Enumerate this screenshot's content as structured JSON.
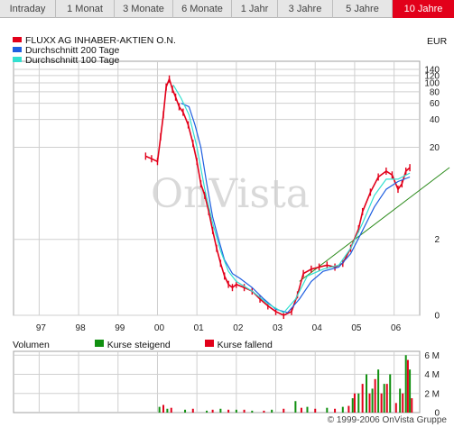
{
  "tabs": [
    {
      "label": "Intraday",
      "active": false
    },
    {
      "label": "1 Monat",
      "active": false
    },
    {
      "label": "3 Monate",
      "active": false
    },
    {
      "label": "6 Monate",
      "active": false
    },
    {
      "label": "1 Jahr",
      "active": false
    },
    {
      "label": "3 Jahre",
      "active": false
    },
    {
      "label": "5 Jahre",
      "active": false
    },
    {
      "label": "10 Jahre",
      "active": true
    }
  ],
  "legend": [
    {
      "label": "FLUXX AG INHABER-AKTIEN O.N.",
      "color": "#e2001a"
    },
    {
      "label": "Durchschnitt 200 Tage",
      "color": "#1f5fe0"
    },
    {
      "label": "Durchschnitt 100 Tage",
      "color": "#33e0d0"
    }
  ],
  "currency": "EUR",
  "watermark": "OnVista",
  "volume_legend": {
    "title": "Volumen",
    "rising": {
      "label": "Kurse steigend",
      "color": "#109010"
    },
    "falling": {
      "label": "Kurse fallend",
      "color": "#e2001a"
    }
  },
  "copyright": "© 1999-2006 OnVista Gruppe",
  "colors": {
    "trendline": "#2a8a1a",
    "grid": "#cfcfcf"
  },
  "chart_data": [
    {
      "type": "line",
      "x": [
        "97",
        "98",
        "99",
        "00",
        "01",
        "02",
        "03",
        "04",
        "05",
        "06"
      ],
      "yscale": "log",
      "yticks": [
        0,
        2,
        20,
        40,
        60,
        80,
        100,
        120,
        140
      ],
      "series": [
        {
          "name": "FLUXX AG INHABER-AKTIEN O.N.",
          "color": "#e2001a",
          "points": [
            [
              1999.7,
              16
            ],
            [
              1999.85,
              15
            ],
            [
              2000.0,
              14
            ],
            [
              2000.08,
              26
            ],
            [
              2000.15,
              45
            ],
            [
              2000.22,
              90
            ],
            [
              2000.3,
              110
            ],
            [
              2000.38,
              85
            ],
            [
              2000.46,
              70
            ],
            [
              2000.55,
              55
            ],
            [
              2000.65,
              48
            ],
            [
              2000.78,
              35
            ],
            [
              2000.9,
              22
            ],
            [
              2001.0,
              14
            ],
            [
              2001.1,
              8
            ],
            [
              2001.2,
              6
            ],
            [
              2001.3,
              4
            ],
            [
              2001.4,
              2.5
            ],
            [
              2001.5,
              1.6
            ],
            [
              2001.6,
              1.1
            ],
            [
              2001.7,
              0.8
            ],
            [
              2001.8,
              0.65
            ],
            [
              2001.9,
              0.6
            ],
            [
              2002.0,
              0.65
            ],
            [
              2002.2,
              0.6
            ],
            [
              2002.4,
              0.55
            ],
            [
              2002.6,
              0.45
            ],
            [
              2002.8,
              0.38
            ],
            [
              2003.0,
              0.33
            ],
            [
              2003.2,
              0.3
            ],
            [
              2003.4,
              0.33
            ],
            [
              2003.55,
              0.5
            ],
            [
              2003.7,
              0.85
            ],
            [
              2003.9,
              0.95
            ],
            [
              2004.1,
              1.0
            ],
            [
              2004.3,
              1.05
            ],
            [
              2004.5,
              1.0
            ],
            [
              2004.7,
              1.1
            ],
            [
              2004.9,
              1.6
            ],
            [
              2005.1,
              2.6
            ],
            [
              2005.2,
              4.0
            ],
            [
              2005.4,
              6.5
            ],
            [
              2005.6,
              9.5
            ],
            [
              2005.8,
              11
            ],
            [
              2005.95,
              10
            ],
            [
              2006.1,
              7
            ],
            [
              2006.2,
              8
            ],
            [
              2006.3,
              11
            ],
            [
              2006.4,
              12
            ]
          ]
        },
        {
          "name": "Durchschnitt 200 Tage",
          "color": "#1f5fe0",
          "points": [
            [
              2000.6,
              60
            ],
            [
              2000.8,
              55
            ],
            [
              2000.95,
              35
            ],
            [
              2001.1,
              20
            ],
            [
              2001.25,
              8
            ],
            [
              2001.4,
              3.5
            ],
            [
              2001.55,
              2.0
            ],
            [
              2001.7,
              1.2
            ],
            [
              2001.9,
              0.85
            ],
            [
              2002.1,
              0.75
            ],
            [
              2002.4,
              0.6
            ],
            [
              2002.7,
              0.45
            ],
            [
              2003.0,
              0.35
            ],
            [
              2003.3,
              0.32
            ],
            [
              2003.6,
              0.45
            ],
            [
              2003.9,
              0.7
            ],
            [
              2004.2,
              0.9
            ],
            [
              2004.6,
              1.0
            ],
            [
              2004.9,
              1.4
            ],
            [
              2005.2,
              2.5
            ],
            [
              2005.5,
              4.5
            ],
            [
              2005.8,
              7
            ],
            [
              2006.1,
              8.5
            ],
            [
              2006.4,
              9.5
            ]
          ]
        },
        {
          "name": "Durchschnitt 100 Tage",
          "color": "#33e0d0",
          "points": [
            [
              2000.4,
              95
            ],
            [
              2000.6,
              68
            ],
            [
              2000.8,
              45
            ],
            [
              2001.0,
              20
            ],
            [
              2001.2,
              7
            ],
            [
              2001.4,
              3.0
            ],
            [
              2001.6,
              1.5
            ],
            [
              2001.8,
              0.9
            ],
            [
              2002.0,
              0.7
            ],
            [
              2002.4,
              0.55
            ],
            [
              2002.8,
              0.4
            ],
            [
              2003.2,
              0.32
            ],
            [
              2003.5,
              0.45
            ],
            [
              2003.8,
              0.8
            ],
            [
              2004.2,
              0.95
            ],
            [
              2004.6,
              1.05
            ],
            [
              2004.9,
              1.6
            ],
            [
              2005.2,
              3.0
            ],
            [
              2005.5,
              6.0
            ],
            [
              2005.8,
              9
            ],
            [
              2006.1,
              9
            ],
            [
              2006.4,
              10.5
            ]
          ]
        }
      ],
      "trendline": {
        "from": [
          2003.6,
          0.7
        ],
        "to": [
          2006.85,
          34
        ]
      }
    },
    {
      "type": "bar",
      "yticks": [
        "0",
        "2 M",
        "4 M",
        "6 M"
      ],
      "ylim": [
        0,
        6.4
      ],
      "unit": "M",
      "series": [
        {
          "name": "Kurse steigend",
          "color": "#109010",
          "points": [
            [
              2000.05,
              0.6
            ],
            [
              2000.25,
              0.4
            ],
            [
              2000.7,
              0.3
            ],
            [
              2001.25,
              0.2
            ],
            [
              2001.6,
              0.4
            ],
            [
              2002.0,
              0.3
            ],
            [
              2002.4,
              0.2
            ],
            [
              2002.9,
              0.3
            ],
            [
              2003.5,
              1.2
            ],
            [
              2003.8,
              0.6
            ],
            [
              2004.3,
              0.5
            ],
            [
              2004.7,
              0.6
            ],
            [
              2004.95,
              1.5
            ],
            [
              2005.1,
              2.0
            ],
            [
              2005.3,
              4.0
            ],
            [
              2005.45,
              2.5
            ],
            [
              2005.6,
              4.5
            ],
            [
              2005.75,
              3.0
            ],
            [
              2005.9,
              4.0
            ],
            [
              2006.15,
              2.5
            ],
            [
              2006.3,
              6.0
            ],
            [
              2006.4,
              4.5
            ]
          ]
        },
        {
          "name": "Kurse fallend",
          "color": "#e2001a",
          "points": [
            [
              2000.15,
              0.8
            ],
            [
              2000.35,
              0.5
            ],
            [
              2000.9,
              0.4
            ],
            [
              2001.4,
              0.3
            ],
            [
              2001.8,
              0.3
            ],
            [
              2002.2,
              0.3
            ],
            [
              2002.7,
              0.2
            ],
            [
              2003.2,
              0.4
            ],
            [
              2003.65,
              0.5
            ],
            [
              2004.0,
              0.4
            ],
            [
              2004.5,
              0.4
            ],
            [
              2004.85,
              0.7
            ],
            [
              2005.0,
              2.0
            ],
            [
              2005.2,
              3.0
            ],
            [
              2005.38,
              2.0
            ],
            [
              2005.52,
              3.5
            ],
            [
              2005.68,
              2.0
            ],
            [
              2005.82,
              3.0
            ],
            [
              2006.05,
              1.0
            ],
            [
              2006.22,
              2.0
            ],
            [
              2006.35,
              5.5
            ],
            [
              2006.45,
              1.5
            ]
          ]
        }
      ]
    }
  ]
}
